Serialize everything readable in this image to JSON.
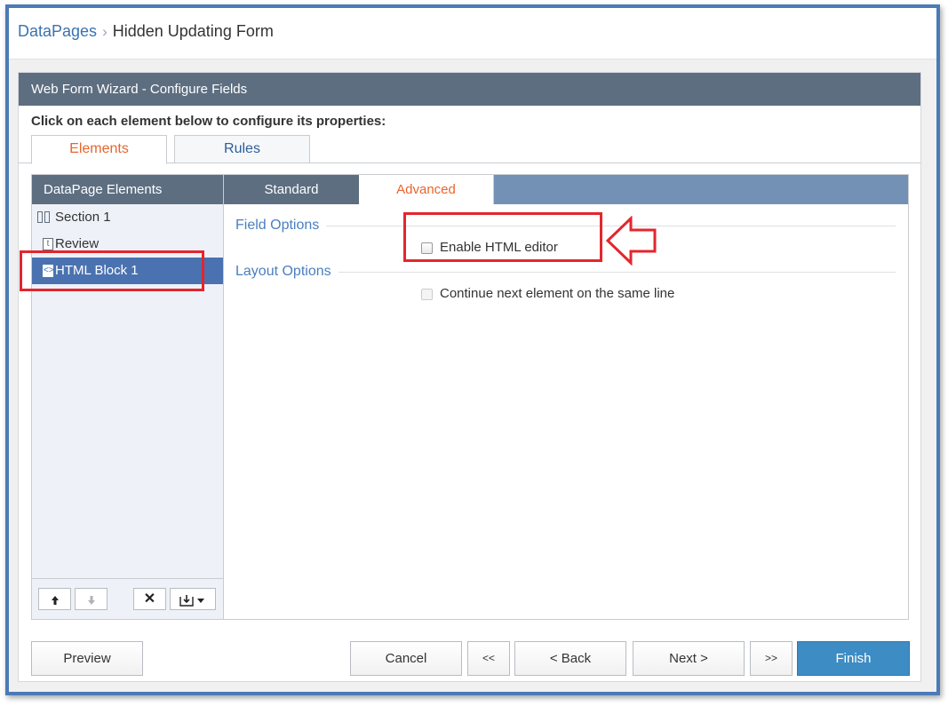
{
  "breadcrumb": {
    "root": "DataPages",
    "separator": "›",
    "current": "Hidden Updating Form"
  },
  "wizard": {
    "title": "Web Form Wizard - Configure Fields",
    "instruction": "Click on each element below to configure its properties:",
    "tabs": [
      {
        "label": "Elements",
        "active": true
      },
      {
        "label": "Rules",
        "active": false
      }
    ]
  },
  "elements_panel": {
    "header": "DataPage Elements",
    "items": [
      {
        "label": "Section 1",
        "icon": "section-icon"
      },
      {
        "label": "Review",
        "icon": "text-field-icon"
      },
      {
        "label": "HTML Block 1",
        "icon": "html-block-icon",
        "selected": true
      }
    ],
    "toolbar": {
      "up": "🠅",
      "down": "🠇",
      "delete": "✕",
      "add": "⭳▾"
    }
  },
  "config": {
    "tabs": [
      {
        "label": "Standard",
        "active": false
      },
      {
        "label": "Advanced",
        "active": true
      }
    ],
    "field_options": {
      "title": "Field Options",
      "enable_html_editor": {
        "label": "Enable HTML editor",
        "checked": false
      }
    },
    "layout_options": {
      "title": "Layout Options",
      "continue_same_line": {
        "label": "Continue next element on the same line",
        "checked": false,
        "disabled": true
      }
    }
  },
  "footer": {
    "preview": "Preview",
    "cancel": "Cancel",
    "first": "<<",
    "back": "< Back",
    "next": "Next >",
    "last": ">>",
    "finish": "Finish"
  },
  "colors": {
    "accent_orange": "#e8652d",
    "header_slate": "#5d6e80",
    "finish_blue": "#3d8cc4",
    "annotation_red": "#e3262d",
    "frame_blue": "#4b7ab8"
  }
}
